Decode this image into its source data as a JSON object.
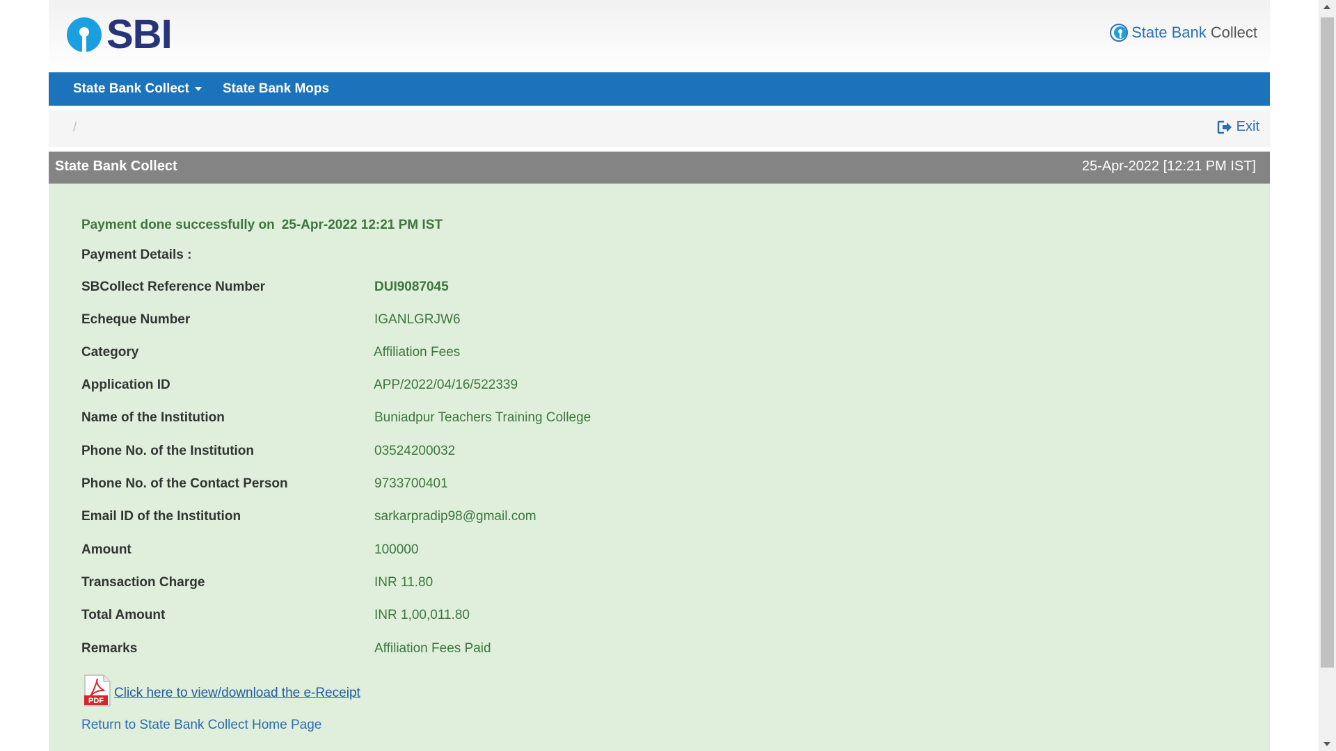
{
  "header": {
    "logo_text": "SBI",
    "brand_right_part1": "State Bank",
    "brand_right_part2": "Collect"
  },
  "nav": {
    "items": [
      {
        "label": "State Bank Collect"
      },
      {
        "label": "State Bank Mops"
      }
    ]
  },
  "breadcrumb": {
    "separator": "/",
    "exit_label": "Exit"
  },
  "panel": {
    "title": "State Bank Collect",
    "datetime": "25-Apr-2022 [12:21 PM IST]"
  },
  "status": {
    "message": "Payment done successfully on",
    "datetime": "25-Apr-2022 12:21 PM IST"
  },
  "details_heading": "Payment Details :",
  "details": [
    {
      "label": "SBCollect Reference Number",
      "value": "DUI9087045"
    },
    {
      "label": "Echeque Number",
      "value": "IGANLGRJW6"
    },
    {
      "label": "Category",
      "value": "Affiliation Fees"
    },
    {
      "label": "Application ID",
      "value": "APP/2022/04/16/522339"
    },
    {
      "label": "Name of the Institution",
      "value": "Buniadpur Teachers Training College"
    },
    {
      "label": "Phone No. of the Institution",
      "value": "03524200032"
    },
    {
      "label": "Phone No. of the Contact Person",
      "value": "9733700401"
    },
    {
      "label": "Email ID of the Institution",
      "value": "sarkarpradip98@gmail.com"
    },
    {
      "label": "Amount",
      "value": "100000"
    },
    {
      "label": "Transaction Charge",
      "value": "INR 11.80"
    },
    {
      "label": "Total Amount",
      "value": "INR 1,00,011.80"
    },
    {
      "label": "Remarks",
      "value": "Affiliation Fees Paid"
    }
  ],
  "receipt": {
    "icon_text": "PDF",
    "link_label": "Click here to view/download the e-Receipt"
  },
  "home_link": "Return to State Bank Collect Home Page",
  "colors": {
    "navbar": "#1b74bb",
    "panel_heading": "#848484",
    "success_bg": "#dfefdb",
    "success_text": "#3c763d",
    "link": "#2a6db0",
    "sbi_blue": "#27337b",
    "sbi_cyan": "#1aa0e0"
  }
}
